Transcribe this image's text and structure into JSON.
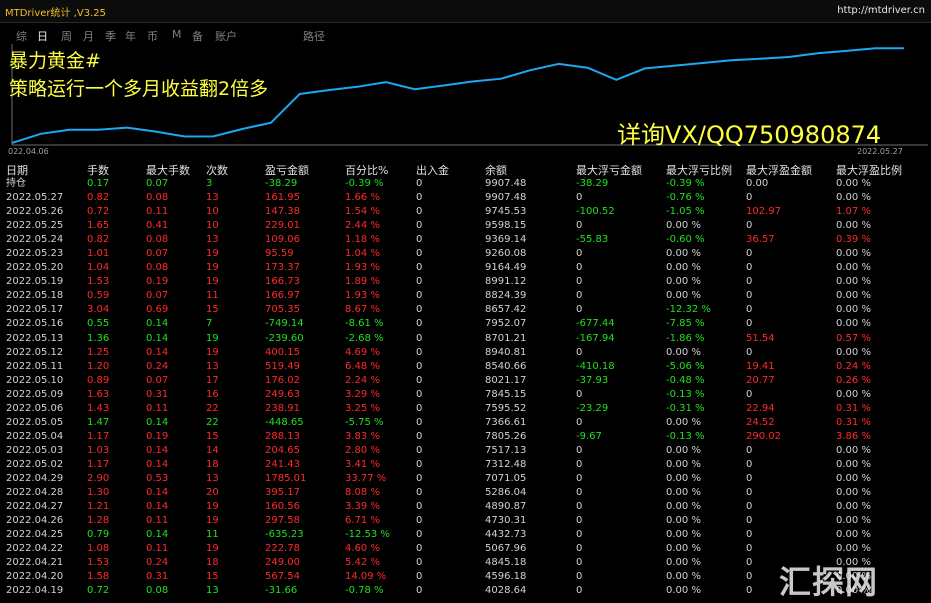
{
  "app": {
    "title": "MTDriver统计 ,V3.25",
    "url": "http://mtdriver.cn"
  },
  "tabs": [
    {
      "label": "综",
      "active": false
    },
    {
      "label": "日",
      "active": true
    },
    {
      "label": "周",
      "active": false
    },
    {
      "label": "月",
      "active": false
    },
    {
      "label": "季",
      "active": false
    },
    {
      "label": "年",
      "active": false
    },
    {
      "label": "币",
      "active": false
    },
    {
      "label": "M",
      "active": false
    },
    {
      "label": "备",
      "active": false
    },
    {
      "label": "账户",
      "active": false
    },
    {
      "label": "路径",
      "active": false
    }
  ],
  "overlay": {
    "line1": "暴力黄金#",
    "line2": "策略运行一个多月收益翻2倍多",
    "line3": "详询VX/QQ750980874"
  },
  "chart_data": {
    "type": "line",
    "x_start_label": "022.04.06",
    "x_end_label": "2022.05.27",
    "line_color": "#1ea8f0",
    "values": [
      4028.64,
      4596.18,
      4845.18,
      4845.18,
      4980.0,
      4730.31,
      4430.0,
      4432.73,
      4890.87,
      5286.04,
      7071.05,
      7312.48,
      7517.13,
      7805.26,
      7366.61,
      7595.52,
      7845.15,
      8021.17,
      8540.66,
      8940.81,
      8701.21,
      7952.07,
      8657.42,
      8824.39,
      8991.12,
      9164.49,
      9260.08,
      9369.14,
      9598.15,
      9745.53,
      9907.48,
      9907.48
    ]
  },
  "colors": {
    "profit": "#ff2a2a",
    "loss": "#20e020",
    "neutral": "#d2d2d2",
    "accent": "#ffff40"
  },
  "table": {
    "headers": [
      "日期",
      "手数",
      "最大手数",
      "次数",
      "盈亏金额",
      "百分比%",
      "出入金",
      "余额",
      "最大浮亏金额",
      "最大浮亏比例",
      "最大浮盈金额",
      "最大浮盈比例"
    ],
    "rows": [
      {
        "c": "g",
        "d": [
          "持仓",
          "0.17",
          "0.07",
          "3",
          "-38.29",
          "-0.39 %",
          "0",
          "9907.48",
          "-38.29",
          "-0.39 %",
          "0.00",
          "0.00 %"
        ]
      },
      {
        "c": "r",
        "d": [
          "2022.05.27",
          "0.82",
          "0.08",
          "13",
          "161.95",
          "1.66 %",
          "0",
          "9907.48",
          "0",
          "-0.76 %",
          "0",
          "0.00 %"
        ]
      },
      {
        "c": "r",
        "d": [
          "2022.05.26",
          "0.72",
          "0.11",
          "10",
          "147.38",
          "1.54 %",
          "0",
          "9745.53",
          "-100.52",
          "-1.05 %",
          "102.97",
          "1.07 %"
        ]
      },
      {
        "c": "r",
        "d": [
          "2022.05.25",
          "1.65",
          "0.41",
          "10",
          "229.01",
          "2.44 %",
          "0",
          "9598.15",
          "0",
          "0.00 %",
          "0",
          "0.00 %"
        ]
      },
      {
        "c": "r",
        "d": [
          "2022.05.24",
          "0.82",
          "0.08",
          "13",
          "109.06",
          "1.18 %",
          "0",
          "9369.14",
          "-55.83",
          "-0.60 %",
          "36.57",
          "0.39 %"
        ]
      },
      {
        "c": "r",
        "d": [
          "2022.05.23",
          "1.01",
          "0.07",
          "19",
          "95.59",
          "1.04 %",
          "0",
          "9260.08",
          "0",
          "0.00 %",
          "0",
          "0.00 %"
        ]
      },
      {
        "c": "r",
        "d": [
          "2022.05.20",
          "1.04",
          "0.08",
          "19",
          "173.37",
          "1.93 %",
          "0",
          "9164.49",
          "0",
          "0.00 %",
          "0",
          "0.00 %"
        ]
      },
      {
        "c": "r",
        "d": [
          "2022.05.19",
          "1.53",
          "0.19",
          "19",
          "166.73",
          "1.89 %",
          "0",
          "8991.12",
          "0",
          "0.00 %",
          "0",
          "0.00 %"
        ]
      },
      {
        "c": "r",
        "d": [
          "2022.05.18",
          "0.59",
          "0.07",
          "11",
          "166.97",
          "1.93 %",
          "0",
          "8824.39",
          "0",
          "0.00 %",
          "0",
          "0.00 %"
        ]
      },
      {
        "c": "r",
        "d": [
          "2022.05.17",
          "3.04",
          "0.69",
          "15",
          "705.35",
          "8.67 %",
          "0",
          "8657.42",
          "0",
          "-12.32 %",
          "0",
          "0.00 %"
        ]
      },
      {
        "c": "g",
        "d": [
          "2022.05.16",
          "0.55",
          "0.14",
          "7",
          "-749.14",
          "-8.61 %",
          "0",
          "7952.07",
          "-677.44",
          "-7.85 %",
          "0",
          "0.00 %"
        ]
      },
      {
        "c": "g",
        "d": [
          "2022.05.13",
          "1.36",
          "0.14",
          "19",
          "-239.60",
          "-2.68 %",
          "0",
          "8701.21",
          "-167.94",
          "-1.86 %",
          "51.54",
          "0.57 %"
        ]
      },
      {
        "c": "r",
        "d": [
          "2022.05.12",
          "1.25",
          "0.14",
          "19",
          "400.15",
          "4.69 %",
          "0",
          "8940.81",
          "0",
          "0.00 %",
          "0",
          "0.00 %"
        ]
      },
      {
        "c": "r",
        "d": [
          "2022.05.11",
          "1.20",
          "0.24",
          "13",
          "519.49",
          "6.48 %",
          "0",
          "8540.66",
          "-410.18",
          "-5.06 %",
          "19.41",
          "0.24 %"
        ]
      },
      {
        "c": "r",
        "d": [
          "2022.05.10",
          "0.89",
          "0.07",
          "17",
          "176.02",
          "2.24 %",
          "0",
          "8021.17",
          "-37.93",
          "-0.48 %",
          "20.77",
          "0.26 %"
        ]
      },
      {
        "c": "r",
        "d": [
          "2022.05.09",
          "1.63",
          "0.31",
          "16",
          "249.63",
          "3.29 %",
          "0",
          "7845.15",
          "0",
          "-0.13 %",
          "0",
          "0.00 %"
        ]
      },
      {
        "c": "r",
        "d": [
          "2022.05.06",
          "1.43",
          "0.11",
          "22",
          "238.91",
          "3.25 %",
          "0",
          "7595.52",
          "-23.29",
          "-0.31 %",
          "22.94",
          "0.31 %"
        ]
      },
      {
        "c": "g",
        "d": [
          "2022.05.05",
          "1.47",
          "0.14",
          "22",
          "-448.65",
          "-5.75 %",
          "0",
          "7366.61",
          "0",
          "0.00 %",
          "24.52",
          "0.31 %"
        ]
      },
      {
        "c": "r",
        "d": [
          "2022.05.04",
          "1.17",
          "0.19",
          "15",
          "288.13",
          "3.83 %",
          "0",
          "7805.26",
          "-9.67",
          "-0.13 %",
          "290.02",
          "3.86 %"
        ]
      },
      {
        "c": "r",
        "d": [
          "2022.05.03",
          "1.03",
          "0.14",
          "14",
          "204.65",
          "2.80 %",
          "0",
          "7517.13",
          "0",
          "0.00 %",
          "0",
          "0.00 %"
        ]
      },
      {
        "c": "r",
        "d": [
          "2022.05.02",
          "1.17",
          "0.14",
          "18",
          "241.43",
          "3.41 %",
          "0",
          "7312.48",
          "0",
          "0.00 %",
          "0",
          "0.00 %"
        ]
      },
      {
        "c": "r",
        "d": [
          "2022.04.29",
          "2.90",
          "0.53",
          "13",
          "1785.01",
          "33.77 %",
          "0",
          "7071.05",
          "0",
          "0.00 %",
          "0",
          "0.00 %"
        ]
      },
      {
        "c": "r",
        "d": [
          "2022.04.28",
          "1.30",
          "0.14",
          "20",
          "395.17",
          "8.08 %",
          "0",
          "5286.04",
          "0",
          "0.00 %",
          "0",
          "0.00 %"
        ]
      },
      {
        "c": "r",
        "d": [
          "2022.04.27",
          "1.21",
          "0.14",
          "19",
          "160.56",
          "3.39 %",
          "0",
          "4890.87",
          "0",
          "0.00 %",
          "0",
          "0.00 %"
        ]
      },
      {
        "c": "r",
        "d": [
          "2022.04.26",
          "1.28",
          "0.11",
          "19",
          "297.58",
          "6.71 %",
          "0",
          "4730.31",
          "0",
          "0.00 %",
          "0",
          "0.00 %"
        ]
      },
      {
        "c": "g",
        "d": [
          "2022.04.25",
          "0.79",
          "0.14",
          "11",
          "-635.23",
          "-12.53 %",
          "0",
          "4432.73",
          "0",
          "0.00 %",
          "0",
          "0.00 %"
        ]
      },
      {
        "c": "r",
        "d": [
          "2022.04.22",
          "1.08",
          "0.11",
          "19",
          "222.78",
          "4.60 %",
          "0",
          "5067.96",
          "0",
          "0.00 %",
          "0",
          "0.00 %"
        ]
      },
      {
        "c": "r",
        "d": [
          "2022.04.21",
          "1.53",
          "0.24",
          "18",
          "249.00",
          "5.42 %",
          "0",
          "4845.18",
          "0",
          "0.00 %",
          "0",
          "0.00 %"
        ]
      },
      {
        "c": "r",
        "d": [
          "2022.04.20",
          "1.58",
          "0.31",
          "15",
          "567.54",
          "14.09 %",
          "0",
          "4596.18",
          "0",
          "0.00 %",
          "0",
          "0.00 %"
        ]
      },
      {
        "c": "g",
        "d": [
          "2022.04.19",
          "0.72",
          "0.08",
          "13",
          "-31.66",
          "-0.78 %",
          "0",
          "4028.64",
          "0",
          "0.00 %",
          "0",
          "0.00 %"
        ]
      }
    ]
  },
  "watermark": "汇探网"
}
